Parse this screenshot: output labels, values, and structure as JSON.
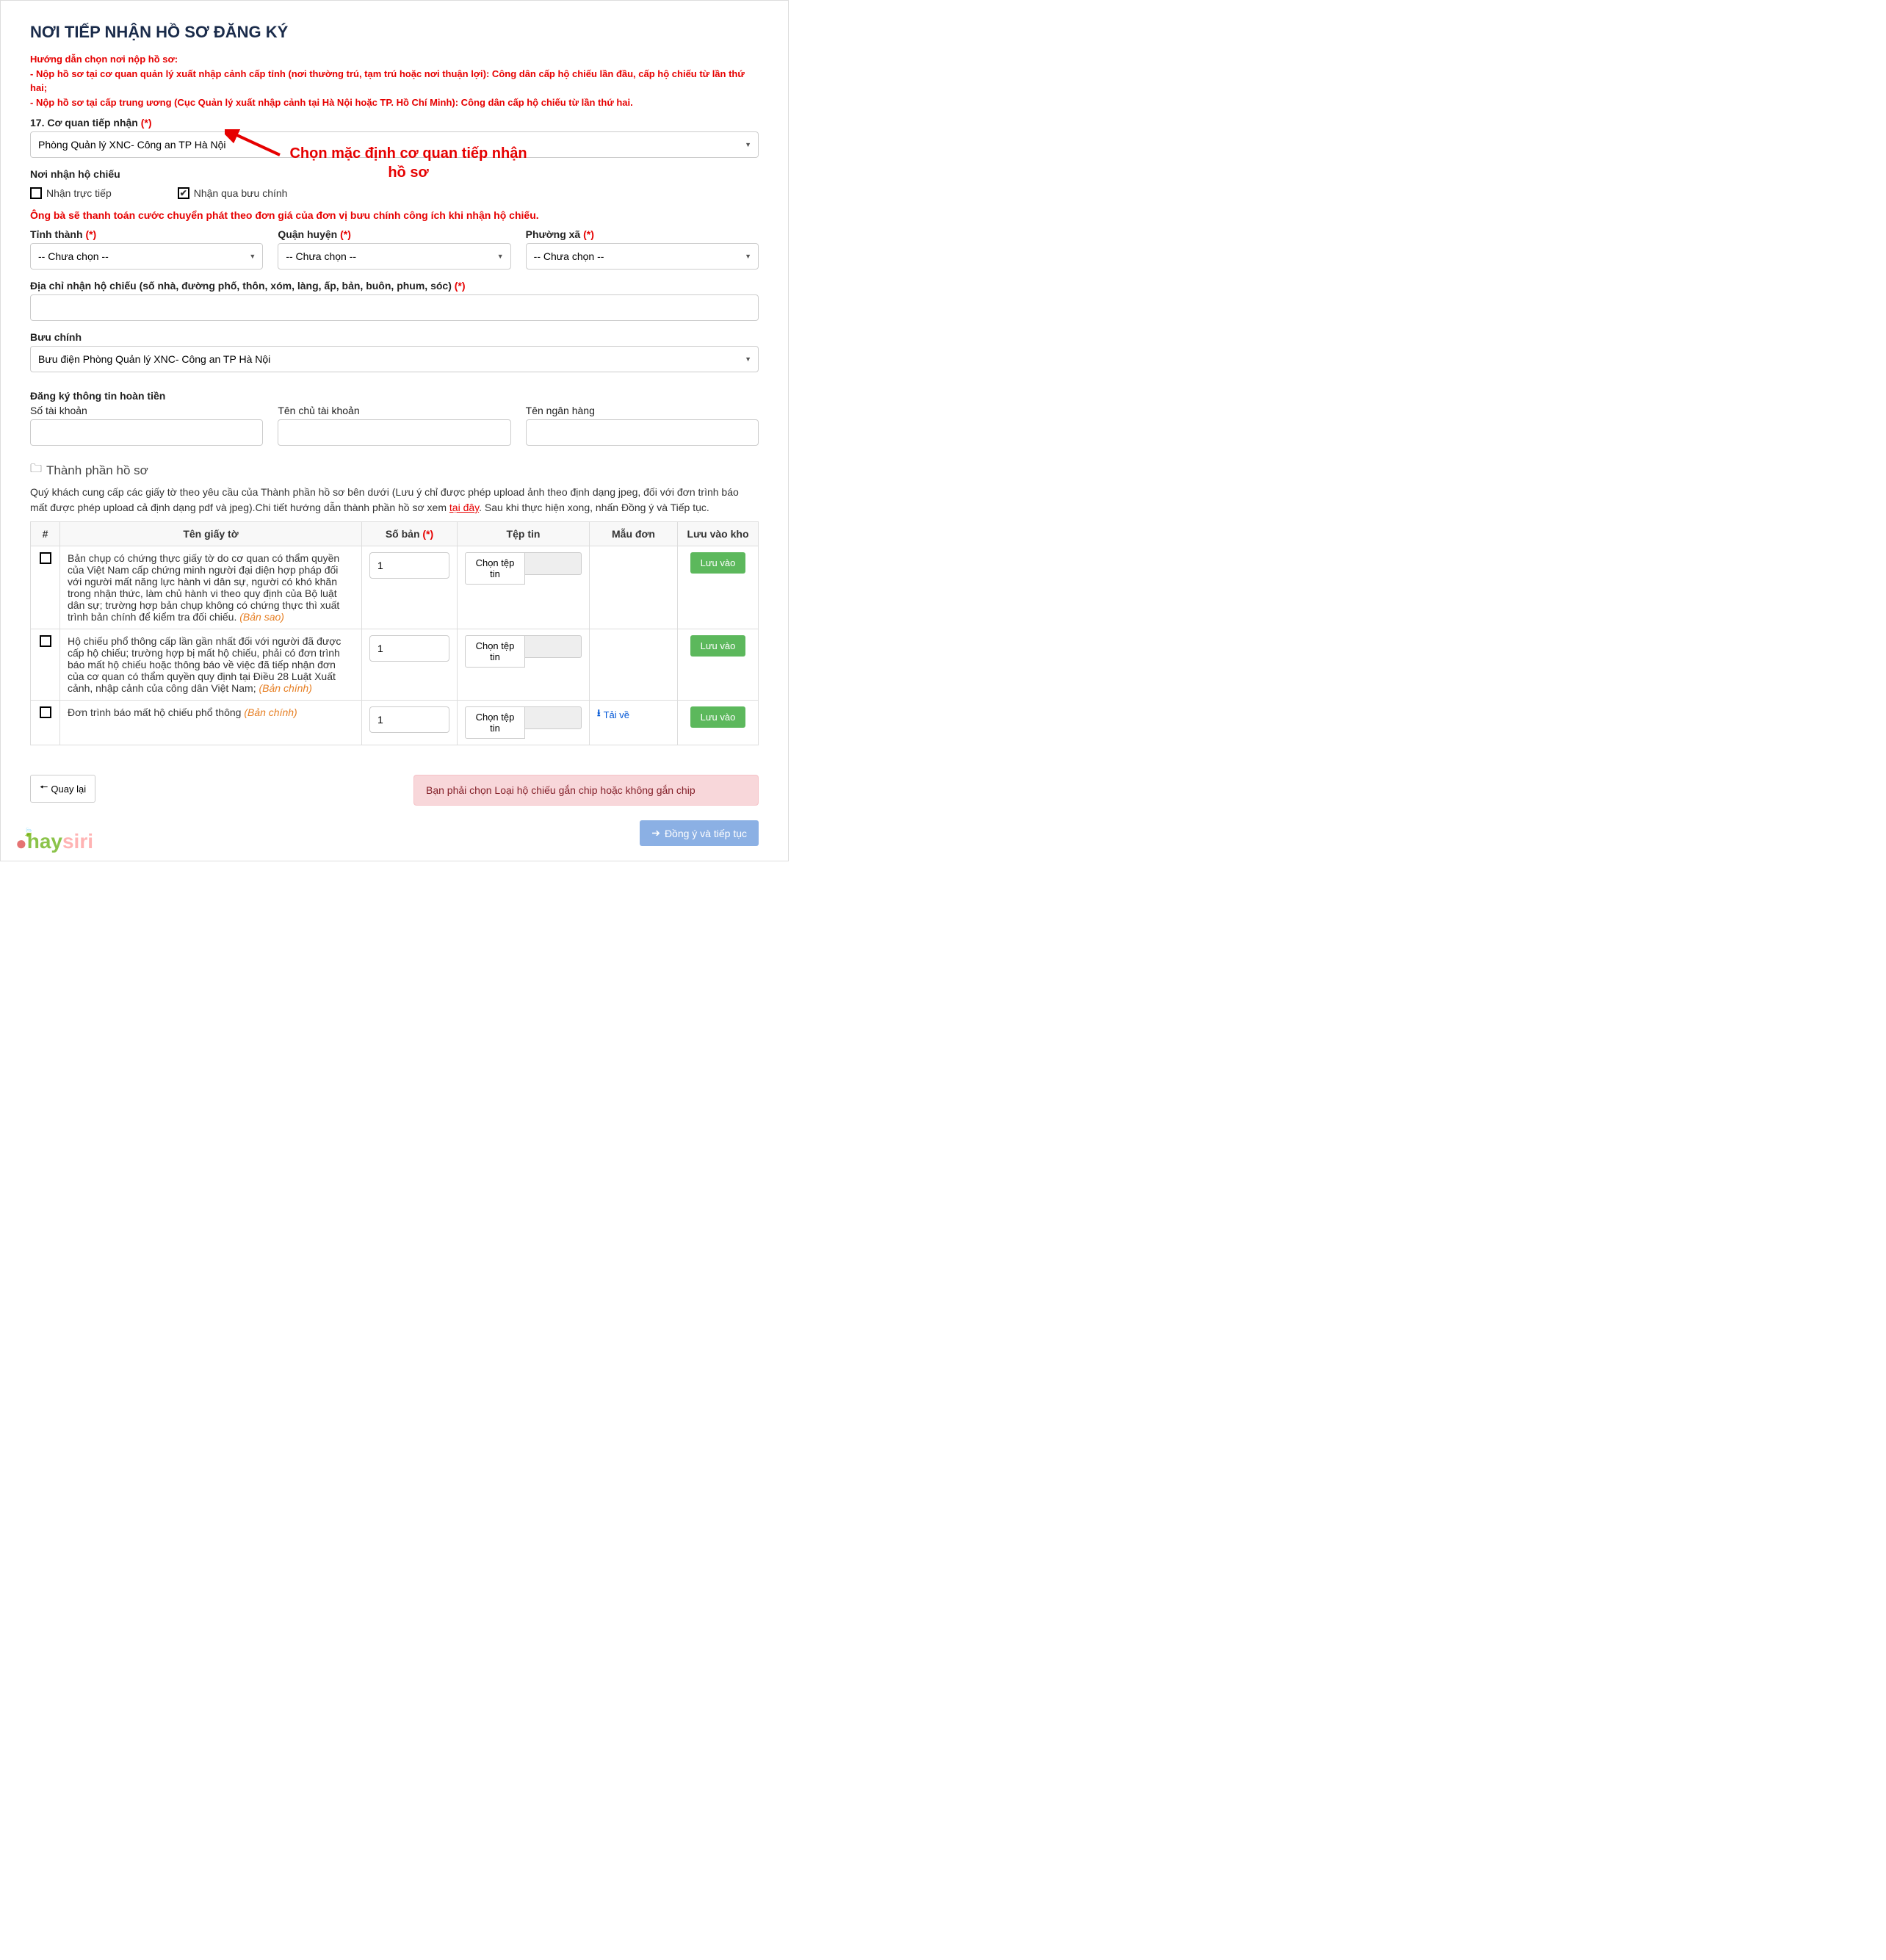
{
  "title": "NƠI TIẾP NHẬN HỒ SƠ ĐĂNG KÝ",
  "instructions": {
    "line0": "Hướng dẫn chọn nơi nộp hồ sơ:",
    "line1": "- Nộp hồ sơ tại cơ quan quản lý xuất nhập cảnh cấp tỉnh (nơi thường trú, tạm trú hoặc nơi thuận lợi): Công dân cấp hộ chiếu lần đầu, cấp hộ chiếu từ lần thứ hai;",
    "line2": "- Nộp hồ sơ tại cấp trung ương (Cục Quản lý xuất nhập cảnh tại Hà Nội hoặc TP. Hồ Chí Minh): Công dân cấp hộ chiếu từ lần thứ hai."
  },
  "field17": {
    "label": "17. Cơ quan tiếp nhận",
    "req": "(*)",
    "value": "Phòng Quản lý XNC- Công an TP Hà Nội"
  },
  "annotation_text": "Chọn mặc định cơ quan tiếp nhận hồ sơ",
  "receipt": {
    "label": "Nơi nhận hộ chiếu",
    "opt_direct": "Nhận trực tiếp",
    "opt_post": "Nhận qua bưu chính"
  },
  "postal_note": "Ông bà sẽ thanh toán cước chuyển phát theo đơn giá của đơn vị bưu chính công ích khi nhận hộ chiếu.",
  "location": {
    "province_label": "Tỉnh thành",
    "district_label": "Quận huyện",
    "ward_label": "Phường xã",
    "req": "(*)",
    "placeholder": "-- Chưa chọn --"
  },
  "address": {
    "label": "Địa chỉ nhận hộ chiếu (số nhà, đường phố, thôn, xóm, làng, ấp, bản, buôn, phum, sóc)",
    "req": "(*)"
  },
  "postal": {
    "label": "Bưu chính",
    "value": "Bưu điện Phòng Quản lý XNC- Công an TP Hà Nội"
  },
  "refund": {
    "section_label": "Đăng ký thông tin hoàn tiền",
    "acct_no_label": "Số tài khoản",
    "acct_name_label": "Tên chủ tài khoản",
    "bank_label": "Tên ngân hàng"
  },
  "docs": {
    "section_title": "Thành phần hồ sơ",
    "desc_prefix": "Quý khách cung cấp các giấy tờ theo yêu cầu của Thành phần hồ sơ bên dưới (Lưu ý chỉ được phép upload ảnh theo định dạng jpeg, đối với đơn trình báo mất được phép upload cả định dạng pdf và jpeg).Chi tiết hướng dẫn thành phần hồ sơ xem ",
    "desc_link": "tại đây",
    "desc_suffix": ". Sau khi thực hiện xong, nhấn Đồng ý và Tiếp tục.",
    "headers": {
      "num": "#",
      "name": "Tên giấy tờ",
      "qty": "Số bản",
      "qty_req": "(*)",
      "file": "Tệp tin",
      "template": "Mẫu đơn",
      "save": "Lưu vào kho"
    },
    "rows": [
      {
        "name": "Bản chụp có chứng thực giấy tờ do cơ quan có thẩm quyền của Việt Nam cấp chứng minh người đại diện hợp pháp đối với người mất năng lực hành vi dân sự, người có khó khăn trong nhận thức, làm chủ hành vi theo quy định của Bộ luật dân sự; trường hợp bản chụp không có chứng thực thì xuất trình bản chính để kiểm tra đối chiếu.",
        "suffix": "(Bản sao)",
        "qty": "1",
        "file_btn": "Chọn tệp tin",
        "download": "",
        "save_btn": "Lưu vào"
      },
      {
        "name": "Hộ chiếu phổ thông cấp lần gần nhất đối với người đã được cấp hộ chiếu; trường hợp bị mất hộ chiếu, phải có đơn trình báo mất hộ chiếu hoặc thông báo về việc đã tiếp nhận đơn của cơ quan có thẩm quyền quy định tại Điều 28 Luật Xuất cảnh, nhập cảnh của công dân Việt Nam;",
        "suffix": "(Bản chính)",
        "qty": "1",
        "file_btn": "Chọn tệp tin",
        "download": "",
        "save_btn": "Lưu vào"
      },
      {
        "name": "Đơn trình báo mất hộ chiếu phổ thông",
        "suffix": "(Bản chính)",
        "qty": "1",
        "file_btn": "Chọn tệp tin",
        "download": "Tải về",
        "save_btn": "Lưu vào"
      }
    ]
  },
  "footer": {
    "back_btn": "Quay lại",
    "alert": "Bạn phải chọn Loại hộ chiếu gắn chip hoặc không gắn chip",
    "submit_btn": "Đồng ý và tiếp tục"
  }
}
